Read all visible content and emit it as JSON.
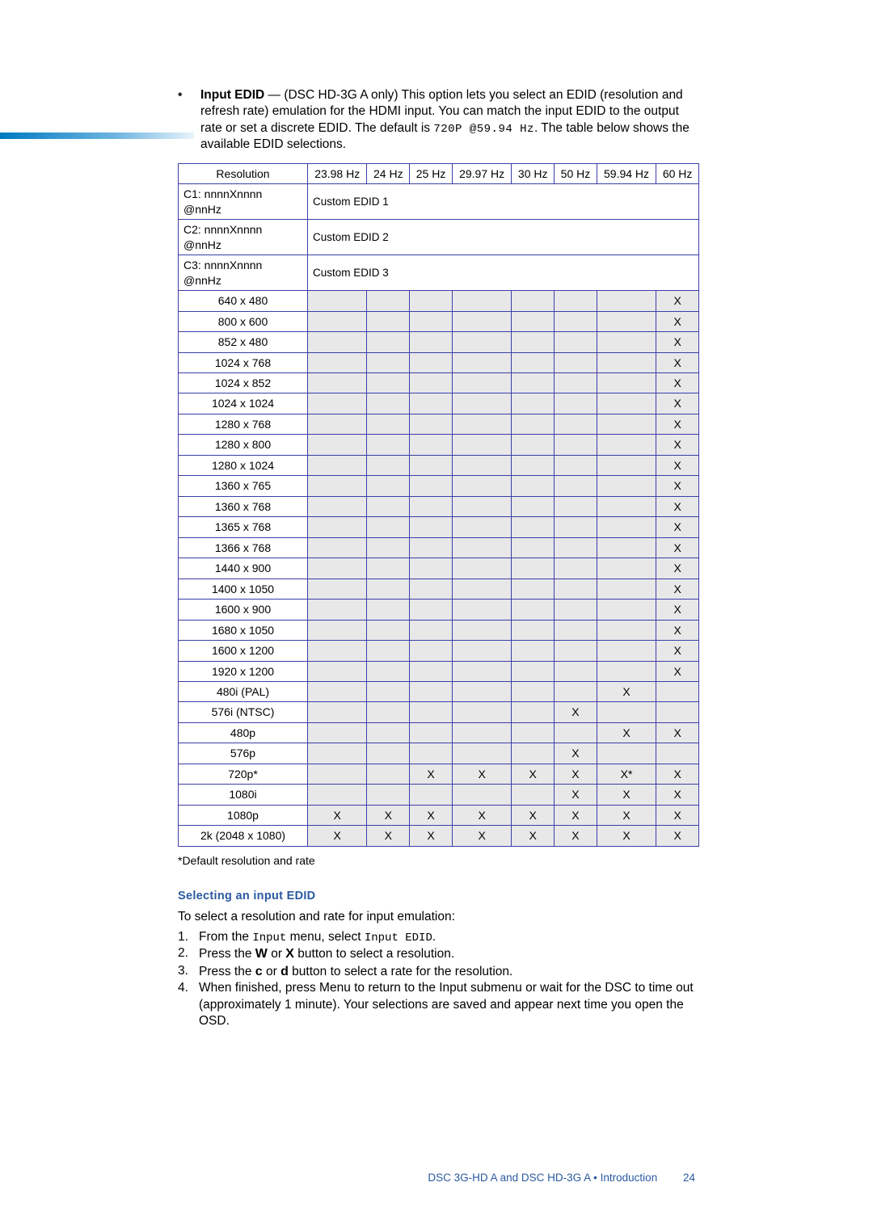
{
  "intro": {
    "label": "Input EDID",
    "suffix": " — (DSC HD-3G A only) This option lets you select an EDID (resolution and refresh rate) emulation for the HDMI input. You can match the input EDID to the output rate or set a discrete EDID. The default is ",
    "default_code": "720P @59.94 Hz",
    "suffix2": ". The table below shows the available EDID selections."
  },
  "table": {
    "headers": [
      "Resolution",
      "23.98 Hz",
      "24 Hz",
      "25 Hz",
      "29.97 Hz",
      "30 Hz",
      "50 Hz",
      "59.94 Hz",
      "60 Hz"
    ],
    "custom_rows": [
      {
        "label": "C1: nnnnXnnnn @nnHz",
        "value": "Custom EDID 1"
      },
      {
        "label": "C2: nnnnXnnnn @nnHz",
        "value": "Custom EDID 2"
      },
      {
        "label": "C3: nnnnXnnnn @nnHz",
        "value": "Custom EDID 3"
      }
    ],
    "rows": [
      {
        "res": "640 x 480",
        "cells": [
          "",
          "",
          "",
          "",
          "",
          "",
          "",
          "X"
        ]
      },
      {
        "res": "800 x 600",
        "cells": [
          "",
          "",
          "",
          "",
          "",
          "",
          "",
          "X"
        ]
      },
      {
        "res": "852 x 480",
        "cells": [
          "",
          "",
          "",
          "",
          "",
          "",
          "",
          "X"
        ]
      },
      {
        "res": "1024 x 768",
        "cells": [
          "",
          "",
          "",
          "",
          "",
          "",
          "",
          "X"
        ]
      },
      {
        "res": "1024 x 852",
        "cells": [
          "",
          "",
          "",
          "",
          "",
          "",
          "",
          "X"
        ]
      },
      {
        "res": "1024 x 1024",
        "cells": [
          "",
          "",
          "",
          "",
          "",
          "",
          "",
          "X"
        ]
      },
      {
        "res": "1280 x 768",
        "cells": [
          "",
          "",
          "",
          "",
          "",
          "",
          "",
          "X"
        ]
      },
      {
        "res": "1280 x 800",
        "cells": [
          "",
          "",
          "",
          "",
          "",
          "",
          "",
          "X"
        ]
      },
      {
        "res": "1280 x 1024",
        "cells": [
          "",
          "",
          "",
          "",
          "",
          "",
          "",
          "X"
        ]
      },
      {
        "res": "1360 x 765",
        "cells": [
          "",
          "",
          "",
          "",
          "",
          "",
          "",
          "X"
        ]
      },
      {
        "res": "1360 x 768",
        "cells": [
          "",
          "",
          "",
          "",
          "",
          "",
          "",
          "X"
        ]
      },
      {
        "res": "1365 x 768",
        "cells": [
          "",
          "",
          "",
          "",
          "",
          "",
          "",
          "X"
        ]
      },
      {
        "res": "1366 x 768",
        "cells": [
          "",
          "",
          "",
          "",
          "",
          "",
          "",
          "X"
        ]
      },
      {
        "res": "1440 x 900",
        "cells": [
          "",
          "",
          "",
          "",
          "",
          "",
          "",
          "X"
        ]
      },
      {
        "res": "1400 x 1050",
        "cells": [
          "",
          "",
          "",
          "",
          "",
          "",
          "",
          "X"
        ]
      },
      {
        "res": "1600 x 900",
        "cells": [
          "",
          "",
          "",
          "",
          "",
          "",
          "",
          "X"
        ]
      },
      {
        "res": "1680 x 1050",
        "cells": [
          "",
          "",
          "",
          "",
          "",
          "",
          "",
          "X"
        ]
      },
      {
        "res": "1600 x 1200",
        "cells": [
          "",
          "",
          "",
          "",
          "",
          "",
          "",
          "X"
        ]
      },
      {
        "res": "1920 x 1200",
        "cells": [
          "",
          "",
          "",
          "",
          "",
          "",
          "",
          "X"
        ]
      },
      {
        "res": "480i (PAL)",
        "cells": [
          "",
          "",
          "",
          "",
          "",
          "",
          "X",
          ""
        ]
      },
      {
        "res": "576i (NTSC)",
        "cells": [
          "",
          "",
          "",
          "",
          "",
          "X",
          "",
          ""
        ]
      },
      {
        "res": "480p",
        "cells": [
          "",
          "",
          "",
          "",
          "",
          "",
          "X",
          "X"
        ]
      },
      {
        "res": "576p",
        "cells": [
          "",
          "",
          "",
          "",
          "",
          "X",
          "",
          ""
        ]
      },
      {
        "res": "720p*",
        "cells": [
          "",
          "",
          "X",
          "X",
          "X",
          "X",
          "X*",
          "X"
        ]
      },
      {
        "res": "1080i",
        "cells": [
          "",
          "",
          "",
          "",
          "",
          "X",
          "X",
          "X"
        ]
      },
      {
        "res": "1080p",
        "cells": [
          "X",
          "X",
          "X",
          "X",
          "X",
          "X",
          "X",
          "X"
        ]
      },
      {
        "res": "2k (2048 x 1080)",
        "cells": [
          "X",
          "X",
          "X",
          "X",
          "X",
          "X",
          "X",
          "X"
        ]
      }
    ],
    "footnote": "*Default resolution and rate"
  },
  "section": {
    "heading": "Selecting an input EDID",
    "lead": "To select a resolution and rate for input emulation:",
    "steps": [
      {
        "n": "1.",
        "pre": "From the ",
        "code1": "Input",
        "mid": " menu, select ",
        "code2": "Input EDID",
        "post": "."
      },
      {
        "n": "2.",
        "pre": "Press the ",
        "big": "W",
        "mid": " or ",
        "big2": "X",
        "post": " button to select a resolution."
      },
      {
        "n": "3.",
        "pre": "Press the ",
        "big": "c",
        "mid": " or ",
        "big2": "d",
        "post": " button to select a rate for the resolution."
      },
      {
        "n": "4.",
        "pre": "When finished, press Menu to return to the Input submenu or wait for the DSC to time out (approximately 1 minute). Your selections are saved and appear next time you open the OSD."
      }
    ]
  },
  "footer": {
    "text": "DSC 3G-HD A and DSC HD-3G A • Introduction",
    "page": "24"
  }
}
